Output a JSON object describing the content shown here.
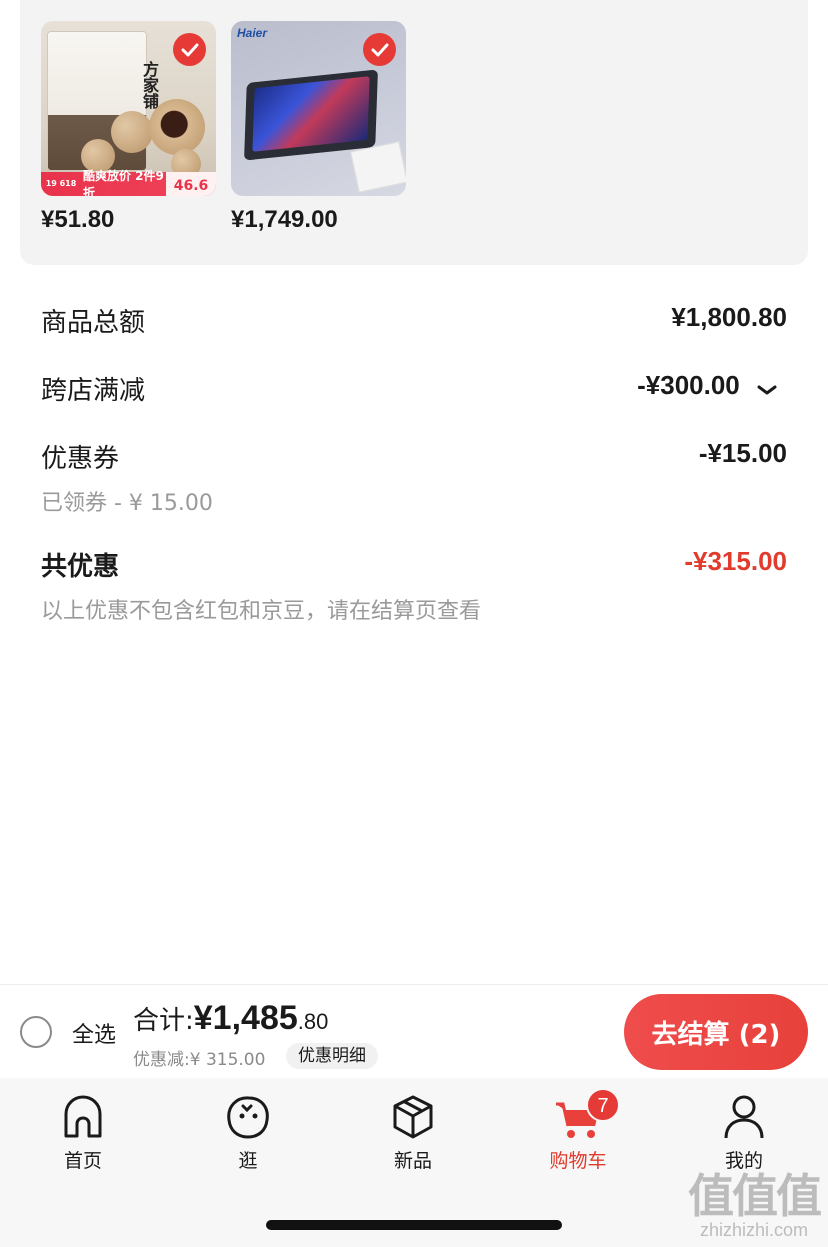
{
  "products": [
    {
      "price": "¥51.80",
      "selected": true,
      "image_text": {
        "bag_title": "方家铺",
        "promo_left": "19 618",
        "promo_text": "酷爽放价 2件9折",
        "promo_price": "46.6"
      }
    },
    {
      "price": "¥1,749.00",
      "selected": true,
      "image_text": {
        "brand": "Haier"
      }
    }
  ],
  "summary": {
    "goods_total_label": "商品总额",
    "goods_total_value": "¥1,800.80",
    "cross_store_label": "跨店满减",
    "cross_store_value": "-¥300.00",
    "coupon_label": "优惠券",
    "coupon_value": "-¥15.00",
    "coupon_note": "已领券 - ¥ 15.00",
    "total_discount_label": "共优惠",
    "total_discount_value": "-¥315.00",
    "disclaimer": "以上优惠不包含红包和京豆，请在结算页查看"
  },
  "bottom_bar": {
    "select_all_label": "全选",
    "total_label": "合计:",
    "total_amount": "¥1,485",
    "total_decimal": ".80",
    "discount_text": "优惠减:¥ 315.00",
    "detail_button": "优惠明细",
    "checkout_button": "去结算 (2)"
  },
  "tabbar": {
    "items": [
      {
        "label": "首页",
        "icon": "home-icon",
        "active": false
      },
      {
        "label": "逛",
        "icon": "browse-face-icon",
        "active": false
      },
      {
        "label": "新品",
        "icon": "new-box-icon",
        "active": false
      },
      {
        "label": "购物车",
        "icon": "cart-icon",
        "active": true,
        "badge": "7"
      },
      {
        "label": "我的",
        "icon": "profile-icon",
        "active": false
      }
    ]
  },
  "watermark": {
    "logo": "值值值",
    "site": "zhizhizhi.com"
  },
  "colors": {
    "accent_red": "#e03b2d",
    "checkout_red": "#ef4c4c",
    "card_bg": "#f3f3f3"
  }
}
